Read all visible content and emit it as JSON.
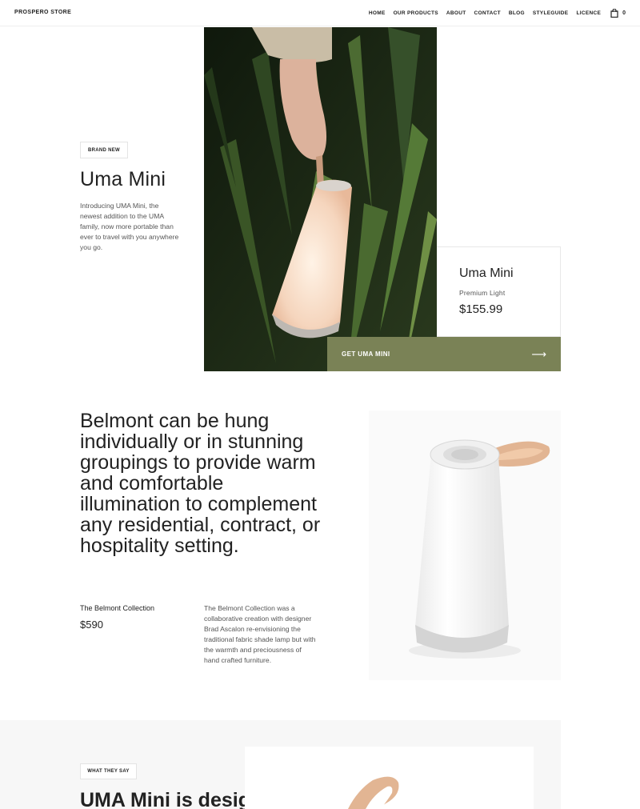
{
  "header": {
    "brand": "PROSPERO STORE",
    "nav": [
      "HOME",
      "OUR PRODUCTS",
      "ABOUT",
      "CONTACT",
      "BLOG",
      "STYLEGUIDE",
      "LICENCE"
    ],
    "cart_count": "0",
    "cart_icon": "shopping-bag-icon"
  },
  "hero": {
    "tag": "BRAND NEW",
    "title": "Uma Mini",
    "description": "Introducing UMA Mini, the newest addition to the UMA family, now more portable than ever to travel with you anywhere you go.",
    "card": {
      "title": "Uma Mini",
      "subtitle": "Premium Light",
      "price": "$155.99"
    },
    "cta": {
      "label": "GET UMA MINI",
      "arrow_icon": "arrow-right-icon"
    }
  },
  "belmont": {
    "quote": "Belmont can be hung individually or in stunning groupings to provide warm and comfortable illumination to complement any residential, contract, or hospitality setting.",
    "collection_name": "The Belmont Collection",
    "price": "$590",
    "description": "The Belmont Collection was a collaborative creation with designer Brad Ascalon re-envisioning the traditional fabric shade lamp but with the warmth and preciousness of hand crafted furniture."
  },
  "testimonials": {
    "tag": "WHAT THEY SAY",
    "heading": "UMA Mini is designed for"
  },
  "colors": {
    "accent": "#7a8256",
    "text": "#222222",
    "muted": "#555555",
    "section_bg": "#f7f7f7"
  }
}
